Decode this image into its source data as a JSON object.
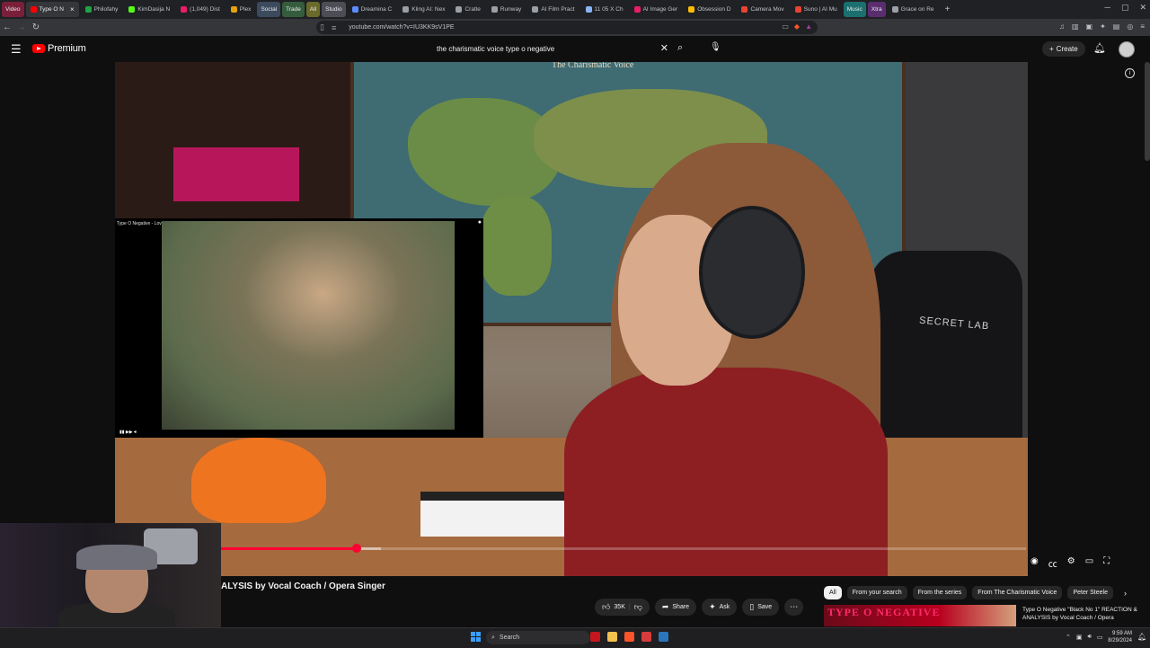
{
  "browser": {
    "tabs": [
      {
        "label": "Video",
        "kind": "group",
        "color": "#7a1f3a"
      },
      {
        "label": "Type O N",
        "color": "#ff0000",
        "active": true
      },
      {
        "label": "Philofahy",
        "color": "#1ea446"
      },
      {
        "label": "KimDasija N",
        "color": "#53fc18"
      },
      {
        "label": "(1,049) Dist",
        "color": "#e91e63"
      },
      {
        "label": "Plex",
        "color": "#e5a00d"
      },
      {
        "label": "Social",
        "kind": "group",
        "color": "#3c4a5e"
      },
      {
        "label": "Trade",
        "kind": "group",
        "color": "#355d3d"
      },
      {
        "label": "All",
        "kind": "group",
        "color": "#6a6a2a"
      },
      {
        "label": "Studio",
        "kind": "group",
        "color": "#4d4d55"
      },
      {
        "label": "Dreamina C",
        "color": "#5b8cff"
      },
      {
        "label": "Kling AI: Nex",
        "color": "#9aa0a6"
      },
      {
        "label": "Cratle",
        "color": "#9aa0a6"
      },
      {
        "label": "Runway",
        "color": "#9aa0a6"
      },
      {
        "label": "AI Film Pract",
        "color": "#9aa0a6"
      },
      {
        "label": "11 05 X Ch",
        "color": "#8ab4f8"
      },
      {
        "label": "AI Image Ger",
        "color": "#e91e63"
      },
      {
        "label": "Obsession D",
        "color": "#fbbc04"
      },
      {
        "label": "Camera Mov",
        "color": "#ea4335"
      },
      {
        "label": "Suno | AI Mu",
        "color": "#ea4335"
      },
      {
        "label": "Music",
        "kind": "group",
        "color": "#1b6f6f"
      },
      {
        "label": "Xtra",
        "kind": "group",
        "color": "#5a2d6f"
      },
      {
        "label": "Grace on Re",
        "color": "#9aa0a6"
      }
    ],
    "new_tab": "+",
    "window_controls": [
      "─",
      "▢",
      "✕"
    ],
    "url": "youtube.com/watch?v=IU3KK9sV1PE"
  },
  "masthead": {
    "logo_text": "Premium",
    "search": {
      "value": "the charismatic voice type o negative",
      "placeholder": "Search"
    },
    "create_label": "Create"
  },
  "video": {
    "map_title": "The Charismatic Voice",
    "chair_text": "SECRET LAB",
    "pip": {
      "title": "Type O Negative - Love You To Death (OFFICIAL VIDEO)"
    },
    "progress_fraction": 0.17,
    "buffer_fraction": 0.2,
    "title": "ALYSIS by Vocal Coach / Opera Singer"
  },
  "actions": {
    "likes": "35K",
    "share": "Share",
    "ask": "Ask",
    "save": "Save"
  },
  "chips": [
    "All",
    "From your search",
    "From the series",
    "From The Charismatic Voice",
    "Peter Steele"
  ],
  "recommendation": {
    "thumb_text": "TYPE O NEGATIVE",
    "title": "Type O Negative \"Black No 1\" REACTION & ANALYSIS by Vocal Coach / Opera"
  },
  "taskbar": {
    "search_label": "Search",
    "time": "9:59 AM",
    "date": "8/29/2024"
  }
}
